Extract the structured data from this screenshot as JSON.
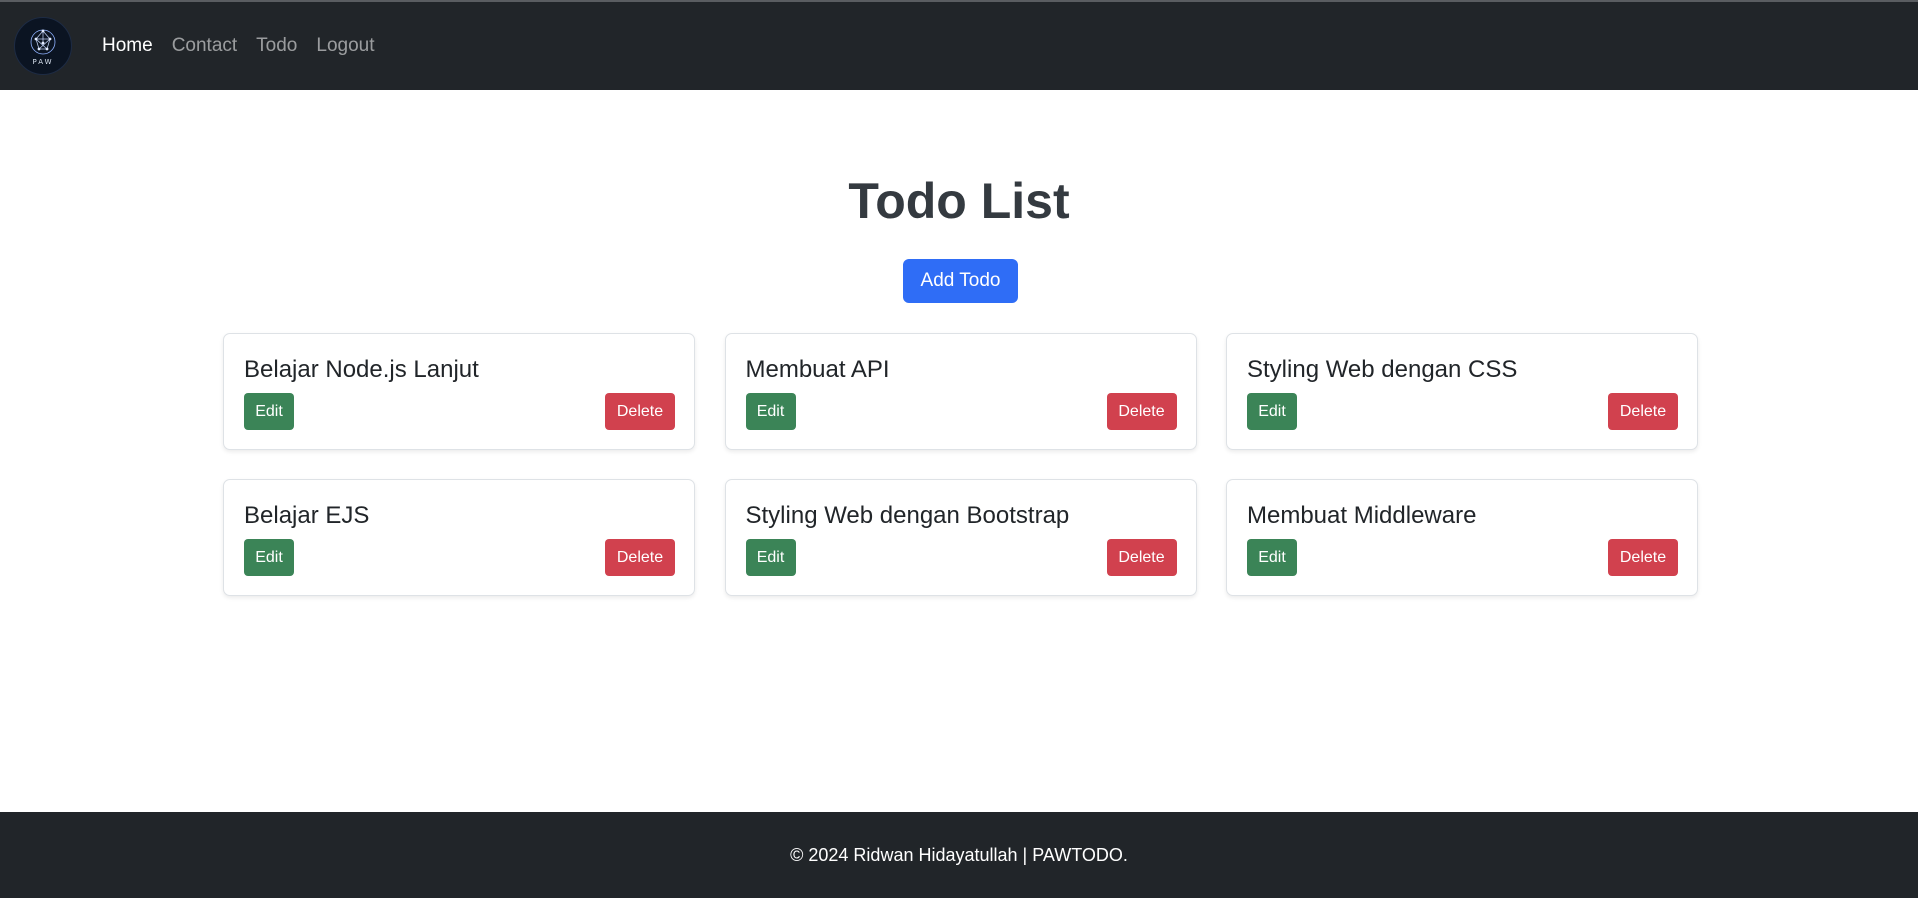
{
  "navbar": {
    "logo_text": "PAW",
    "links": [
      {
        "label": "Home",
        "active": true
      },
      {
        "label": "Contact",
        "active": false
      },
      {
        "label": "Todo",
        "active": false
      },
      {
        "label": "Logout",
        "active": false
      }
    ]
  },
  "main": {
    "title": "Todo List",
    "add_button_label": "Add Todo",
    "todos": [
      {
        "title": "Belajar Node.js Lanjut",
        "edit_label": "Edit",
        "delete_label": "Delete"
      },
      {
        "title": "Membuat API",
        "edit_label": "Edit",
        "delete_label": "Delete"
      },
      {
        "title": "Styling Web dengan CSS",
        "edit_label": "Edit",
        "delete_label": "Delete"
      },
      {
        "title": "Belajar EJS",
        "edit_label": "Edit",
        "delete_label": "Delete"
      },
      {
        "title": "Styling Web dengan Bootstrap",
        "edit_label": "Edit",
        "delete_label": "Delete"
      },
      {
        "title": "Membuat Middleware",
        "edit_label": "Edit",
        "delete_label": "Delete"
      }
    ]
  },
  "footer": {
    "text": "© 2024 Ridwan Hidayatullah | PAWTODO."
  },
  "colors": {
    "navbar_bg": "#212529",
    "primary": "#2f6df6",
    "success": "#3b8457",
    "danger": "#d1414e"
  }
}
